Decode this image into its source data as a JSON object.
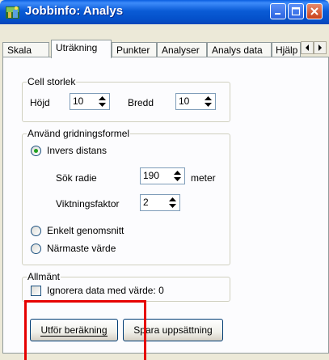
{
  "window": {
    "title": "Jobbinfo: Analys",
    "icon": "app-icon",
    "controls": [
      "minimize-icon",
      "maximize-icon",
      "close-icon"
    ]
  },
  "tabs": [
    {
      "label": "Skala",
      "active": false
    },
    {
      "label": "Uträkning",
      "active": true
    },
    {
      "label": "Punkter",
      "active": false
    },
    {
      "label": "Analyser",
      "active": false
    },
    {
      "label": "Analys data",
      "active": false
    },
    {
      "label": "Hjälp",
      "active": false
    }
  ],
  "cell_size": {
    "legend": "Cell storlek",
    "height_label": "Höjd",
    "height_value": "10",
    "width_label": "Bredd",
    "width_value": "10"
  },
  "grid_formula": {
    "legend": "Använd gridningsformel",
    "inverse_distance": {
      "label": "Invers distans",
      "selected": true
    },
    "search_radius_label": "Sök radie",
    "search_radius_value": "190",
    "search_radius_unit": "meter",
    "weight_factor_label": "Viktningsfaktor",
    "weight_factor_value": "2",
    "simple_average": {
      "label": "Enkelt genomsnitt",
      "selected": false
    },
    "nearest_value": {
      "label": "Närmaste värde",
      "selected": false
    }
  },
  "general": {
    "legend": "Allmänt",
    "ignore_label": "Ignorera data med värde: 0",
    "ignore_checked": false
  },
  "buttons": {
    "compute": "Utför beräkning",
    "save": "Spara uppsättning"
  },
  "colors": {
    "titlebar": "#0a5bd6",
    "highlight": "#e60000",
    "radio_dot": "#21a121"
  }
}
